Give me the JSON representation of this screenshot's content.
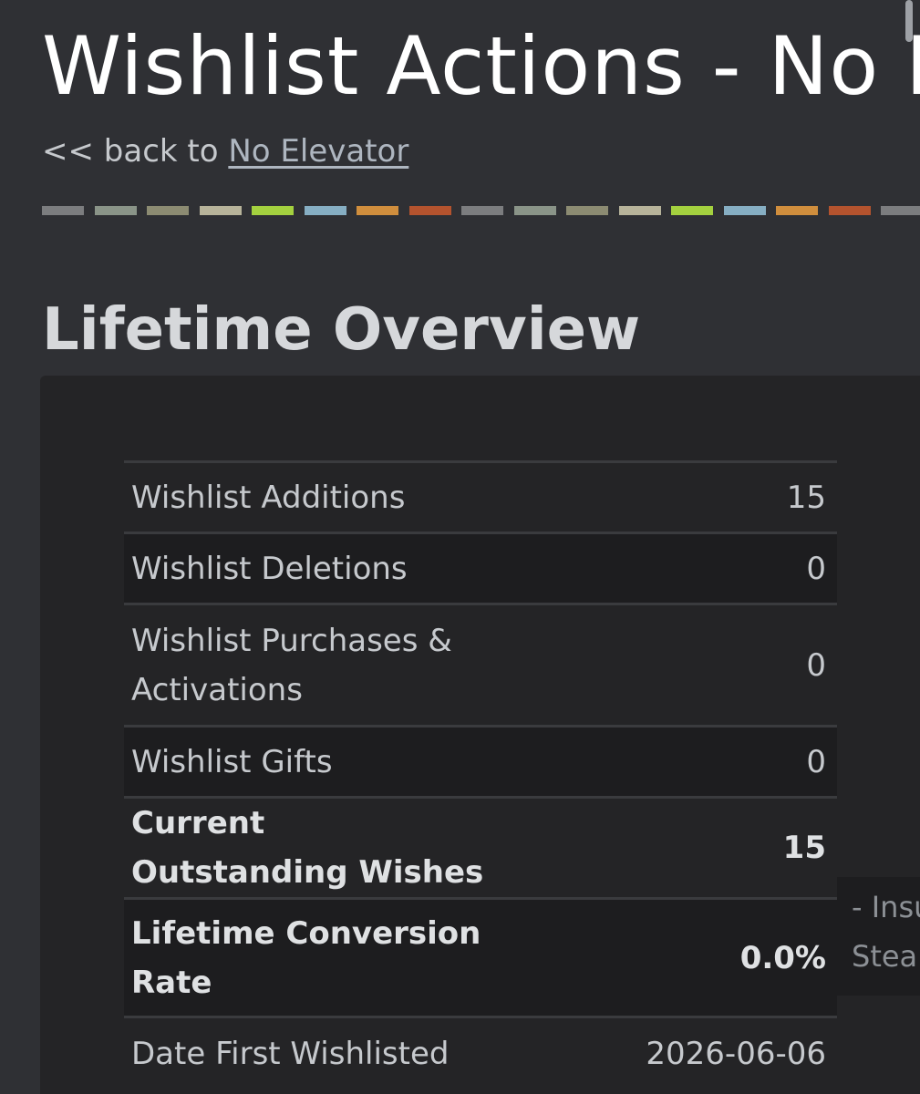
{
  "header": {
    "title": "Wishlist Actions - No Elevator",
    "back_prefix": "<< back to ",
    "back_link": "No Elevator"
  },
  "stripe_colors": [
    "#7c7d7f",
    "#8a9488",
    "#8c8b72",
    "#b7b39a",
    "#a4d13f",
    "#86aec3",
    "#d08e3d",
    "#b4532e",
    "#7c7d7f",
    "#8a9488",
    "#8c8b72",
    "#b7b39a",
    "#a4d13f",
    "#86aec3",
    "#d08e3d",
    "#b4532e",
    "#7c7d7f"
  ],
  "lifetime_overview": {
    "title": "Lifetime Overview",
    "rows": [
      {
        "label": "Wishlist Additions",
        "value": "15"
      },
      {
        "label": "Wishlist Deletions",
        "value": "0"
      },
      {
        "label": "Wishlist Purchases & Activations",
        "value": "0"
      },
      {
        "label": "Wishlist Gifts",
        "value": "0"
      },
      {
        "label": "Current Outstanding Wishes",
        "value": "15"
      },
      {
        "label": "Lifetime Conversion Rate",
        "value": "0.0%"
      },
      {
        "label": "Date First Wishlisted",
        "value": "2026-06-06"
      }
    ],
    "conversion_note": "- Insufficient Steam"
  }
}
